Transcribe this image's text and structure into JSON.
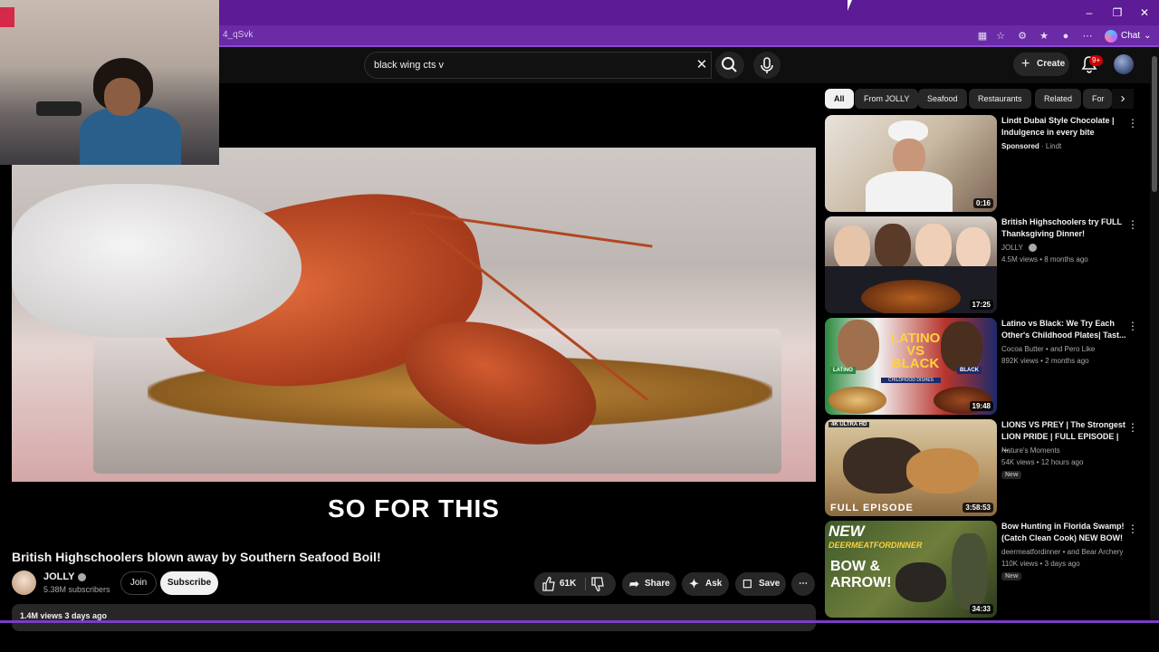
{
  "browser": {
    "url_fragment": "4_qSvk",
    "chat_label": "Chat",
    "window_controls": {
      "minimize": "–",
      "restore": "❐",
      "close": "✕"
    }
  },
  "header": {
    "search_value": "black wing cts v",
    "create_label": "Create",
    "notification_badge": "9+"
  },
  "player": {
    "caption": "SO FOR THIS"
  },
  "video": {
    "title": "British Highschoolers blown away by Southern Seafood Boil!",
    "channel": "JOLLY",
    "subscribers": "5.38M subscribers",
    "join_label": "Join",
    "subscribe_label": "Subscribe",
    "likes": "61K",
    "share_label": "Share",
    "ask_label": "Ask",
    "save_label": "Save",
    "views_date": "1.4M views  3 days ago"
  },
  "chips": [
    "All",
    "From JOLLY",
    "Seafood",
    "Restaurants",
    "Related",
    "For"
  ],
  "recommendations": [
    {
      "title": "Lindt Dubai Style Chocolate | Indulgence in every bite",
      "sponsored": "Sponsored",
      "channel": "Lindt",
      "duration": "0:16"
    },
    {
      "title": "British Highschoolers try FULL Thanksgiving Dinner!",
      "channel": "JOLLY",
      "stats": "4.5M views • 8 months ago",
      "duration": "17:25"
    },
    {
      "title": "Latino vs Black: We Try Each Other's Childhood Plates| Tast...",
      "channel": "Cocoa Butter • and Pero Like",
      "stats": "892K views • 2 months ago",
      "duration": "19:48",
      "thumb_text": [
        "LATINO",
        "VS",
        "BLACK",
        "CHILDHOOD DISHES",
        "LATINO",
        "BLACK"
      ]
    },
    {
      "title": "LIONS VS PREY | The Strongest LION PRIDE | FULL EPISODE | ...",
      "channel": "Nature's Moments",
      "stats": "54K views • 12 hours ago",
      "badge": "New",
      "duration": "3:58:53",
      "thumb_text": [
        "4K ULTRA HD",
        "FULL EPISODE"
      ]
    },
    {
      "title": "Bow Hunting in Florida Swamp! (Catch Clean Cook) NEW BOW!",
      "channel": "deermeatfordinner • and Bear Archery",
      "stats": "110K views • 3 days ago",
      "badge": "New",
      "duration": "34:33",
      "thumb_text": [
        "NEW",
        "DEERMEATFORDINNER",
        "BOW &",
        "ARROW!"
      ]
    }
  ]
}
